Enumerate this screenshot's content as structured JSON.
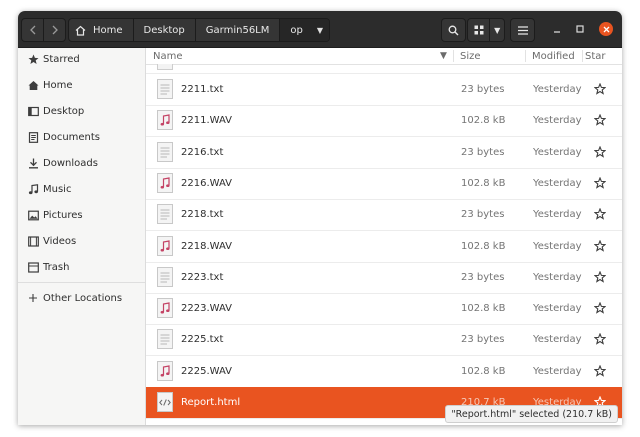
{
  "breadcrumb": {
    "items": [
      "Home",
      "Desktop",
      "Garmin56LM",
      "op"
    ]
  },
  "sidebar": {
    "items": [
      {
        "label": "Starred",
        "icon": "star-icon"
      },
      {
        "label": "Home",
        "icon": "home-icon"
      },
      {
        "label": "Desktop",
        "icon": "desktop-icon"
      },
      {
        "label": "Documents",
        "icon": "documents-icon"
      },
      {
        "label": "Downloads",
        "icon": "downloads-icon"
      },
      {
        "label": "Music",
        "icon": "music-icon"
      },
      {
        "label": "Pictures",
        "icon": "pictures-icon"
      },
      {
        "label": "Videos",
        "icon": "videos-icon"
      },
      {
        "label": "Trash",
        "icon": "trash-icon"
      }
    ],
    "other": {
      "label": "Other Locations",
      "icon": "plus-icon"
    }
  },
  "columns": {
    "name": "Name",
    "size": "Size",
    "modified": "Modified",
    "star": "Star"
  },
  "files": [
    {
      "name": "2211.txt",
      "size": "23 bytes",
      "modified": "Yesterday",
      "type": "text"
    },
    {
      "name": "2211.WAV",
      "size": "102.8 kB",
      "modified": "Yesterday",
      "type": "audio"
    },
    {
      "name": "2216.txt",
      "size": "23 bytes",
      "modified": "Yesterday",
      "type": "text"
    },
    {
      "name": "2216.WAV",
      "size": "102.8 kB",
      "modified": "Yesterday",
      "type": "audio"
    },
    {
      "name": "2218.txt",
      "size": "23 bytes",
      "modified": "Yesterday",
      "type": "text"
    },
    {
      "name": "2218.WAV",
      "size": "102.8 kB",
      "modified": "Yesterday",
      "type": "audio"
    },
    {
      "name": "2223.txt",
      "size": "23 bytes",
      "modified": "Yesterday",
      "type": "text"
    },
    {
      "name": "2223.WAV",
      "size": "102.8 kB",
      "modified": "Yesterday",
      "type": "audio"
    },
    {
      "name": "2225.txt",
      "size": "23 bytes",
      "modified": "Yesterday",
      "type": "text"
    },
    {
      "name": "2225.WAV",
      "size": "102.8 kB",
      "modified": "Yesterday",
      "type": "audio"
    },
    {
      "name": "Report.html",
      "size": "210.7 kB",
      "modified": "Yesterday",
      "type": "html"
    }
  ],
  "status": {
    "text": "\"Report.html\" selected  (210.7 kB)"
  },
  "colors": {
    "accent": "#e95420",
    "headerbar": "#2c2c2c",
    "audio_icon": "#c44365"
  }
}
